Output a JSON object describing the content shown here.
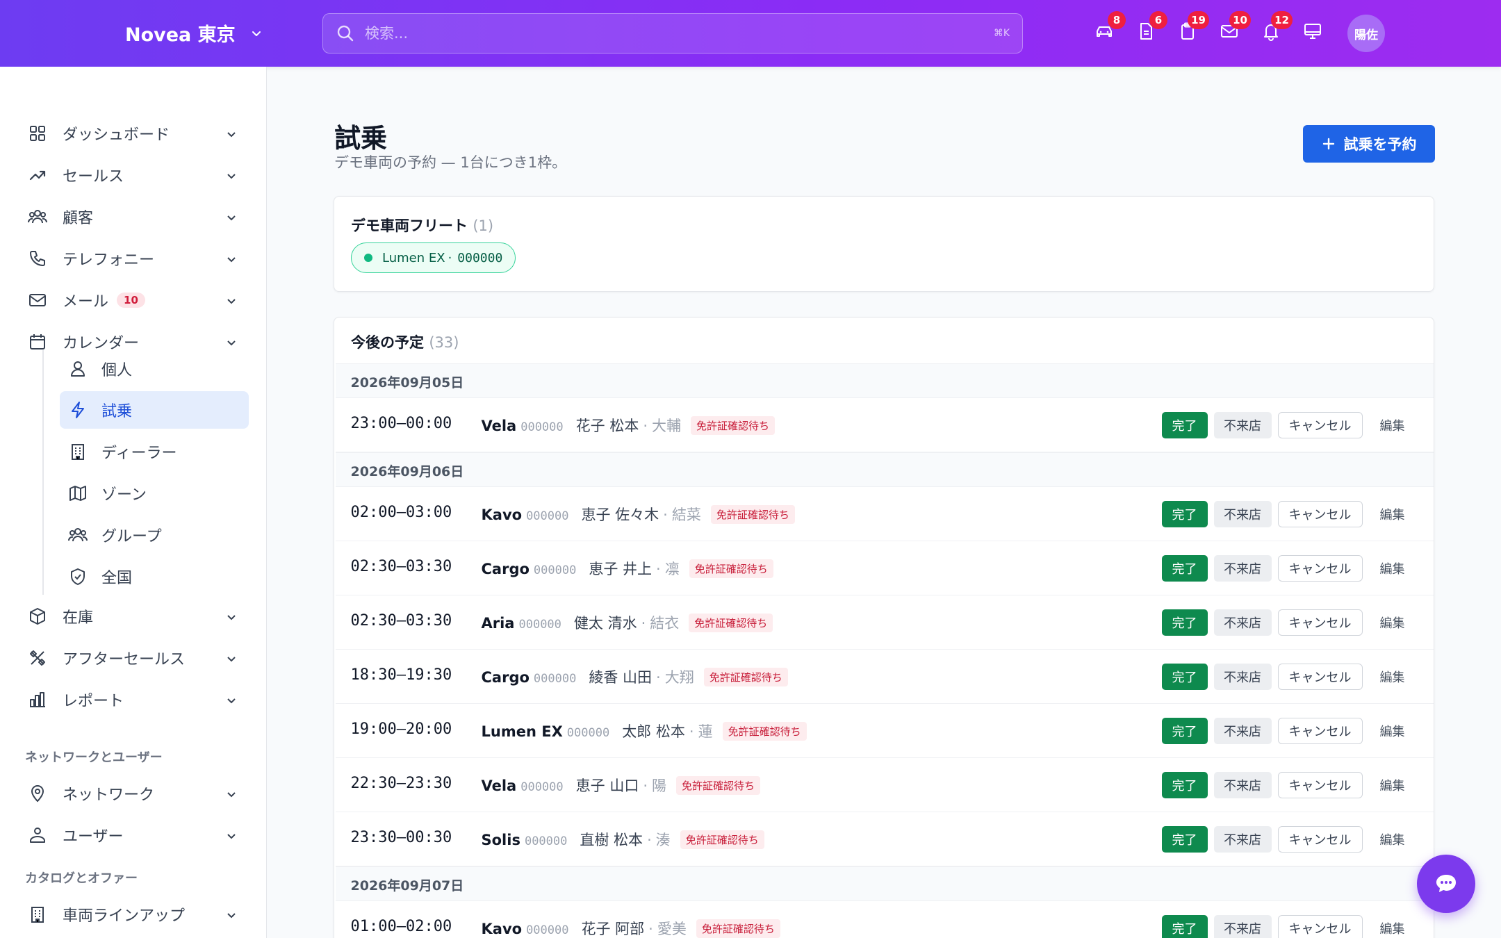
{
  "header": {
    "brand": "Novea 東京",
    "search_placeholder": "検索...",
    "search_shortcut": "⌘K",
    "icons": [
      {
        "name": "car-icon",
        "badge": "8"
      },
      {
        "name": "document-icon",
        "badge": "6"
      },
      {
        "name": "clipboard-icon",
        "badge": "19"
      },
      {
        "name": "mail-icon",
        "badge": "10"
      },
      {
        "name": "bell-icon",
        "badge": "12"
      },
      {
        "name": "monitor-icon",
        "badge": ""
      }
    ],
    "avatar": "陽佐"
  },
  "sidebar": {
    "items": [
      {
        "label": "ダッシュボード",
        "icon": "grid-icon"
      },
      {
        "label": "セールス",
        "icon": "trend-icon"
      },
      {
        "label": "顧客",
        "icon": "users-icon"
      },
      {
        "label": "テレフォニー",
        "icon": "phone-icon"
      },
      {
        "label": "メール",
        "icon": "mail-icon",
        "badge": "10"
      },
      {
        "label": "カレンダー",
        "icon": "calendar-icon"
      }
    ],
    "sub_items": [
      {
        "label": "個人",
        "icon": "user-icon"
      },
      {
        "label": "試乗",
        "icon": "bolt-icon",
        "active": true
      },
      {
        "label": "ディーラー",
        "icon": "building-icon"
      },
      {
        "label": "ゾーン",
        "icon": "map-icon"
      },
      {
        "label": "グループ",
        "icon": "group-icon"
      },
      {
        "label": "全国",
        "icon": "shield-icon"
      }
    ],
    "items2": [
      {
        "label": "在庫",
        "icon": "box-icon"
      },
      {
        "label": "アフターセールス",
        "icon": "tools-icon"
      },
      {
        "label": "レポート",
        "icon": "chart-icon"
      }
    ],
    "section_network": "ネットワークとユーザー",
    "network_items": [
      {
        "label": "ネットワーク",
        "icon": "pin-icon"
      },
      {
        "label": "ユーザー",
        "icon": "user-admin-icon"
      }
    ],
    "section_catalog": "カタログとオファー",
    "catalog_items": [
      {
        "label": "車両ラインアップ",
        "icon": "building-icon"
      }
    ]
  },
  "page": {
    "title": "試乗",
    "subtitle": "デモ車両の予約 — 1台につき1枠。",
    "book_button": "試乗を予約"
  },
  "fleet": {
    "title": "デモ車両フリート",
    "count": "(1)",
    "chip_model": "Lumen EX",
    "chip_sep": "·",
    "chip_plate": "000000"
  },
  "upcoming": {
    "title": "今後の予定",
    "count": "(33)",
    "dates": [
      "2026年09月05日",
      "2026年09月06日",
      "2026年09月07日"
    ],
    "events": [
      {
        "time": "23:00–00:00",
        "model": "Vela",
        "plate": "000000",
        "customer": "花子 松本",
        "sep": "·",
        "sales": "大輔",
        "status": "免許証確認待ち"
      },
      {
        "time": "02:00–03:00",
        "model": "Kavo",
        "plate": "000000",
        "customer": "恵子 佐々木",
        "sep": "·",
        "sales": "結菜",
        "status": "免許証確認待ち"
      },
      {
        "time": "02:30–03:30",
        "model": "Cargo",
        "plate": "000000",
        "customer": "恵子 井上",
        "sep": "·",
        "sales": "凛",
        "status": "免許証確認待ち"
      },
      {
        "time": "02:30–03:30",
        "model": "Aria",
        "plate": "000000",
        "customer": "健太 清水",
        "sep": "·",
        "sales": "結衣",
        "status": "免許証確認待ち"
      },
      {
        "time": "18:30–19:30",
        "model": "Cargo",
        "plate": "000000",
        "customer": "綾香 山田",
        "sep": "·",
        "sales": "大翔",
        "status": "免許証確認待ち"
      },
      {
        "time": "19:00–20:00",
        "model": "Lumen EX",
        "plate": "000000",
        "customer": "太郎 松本",
        "sep": "·",
        "sales": "蓮",
        "status": "免許証確認待ち"
      },
      {
        "time": "22:30–23:30",
        "model": "Vela",
        "plate": "000000",
        "customer": "恵子 山口",
        "sep": "·",
        "sales": "陽",
        "status": "免許証確認待ち"
      },
      {
        "time": "23:30–00:30",
        "model": "Solis",
        "plate": "000000",
        "customer": "直樹 松本",
        "sep": "·",
        "sales": "湊",
        "status": "免許証確認待ち"
      },
      {
        "time": "01:00–02:00",
        "model": "Kavo",
        "plate": "000000",
        "customer": "花子 阿部",
        "sep": "·",
        "sales": "愛美",
        "status": "免許証確認待ち"
      }
    ],
    "actions": {
      "done": "完了",
      "noshow": "不来店",
      "cancel": "キャンセル",
      "edit": "編集"
    }
  },
  "colors": {
    "accent": "#1f64e6",
    "header_start": "#6d3cf2",
    "header_end": "#9d2cf0",
    "success": "#0e8a4e",
    "danger": "#c81e3a"
  }
}
